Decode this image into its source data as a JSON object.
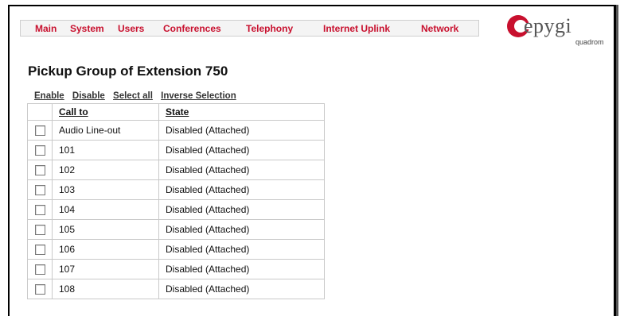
{
  "menu": [
    {
      "label": "Main"
    },
    {
      "label": "System"
    },
    {
      "label": "Users"
    },
    {
      "label": "Conferences"
    },
    {
      "label": "Telephony"
    },
    {
      "label": "Internet Uplink"
    },
    {
      "label": "Network"
    }
  ],
  "brand": {
    "name": "epygi",
    "sub": "quadrom",
    "accent": "#c8102e"
  },
  "page_title": "Pickup Group of Extension 750",
  "actions": {
    "enable": "Enable",
    "disable": "Disable",
    "select_all": "Select all",
    "inverse": "Inverse Selection"
  },
  "table": {
    "headers": {
      "call_to": "Call to",
      "state": "State"
    },
    "rows": [
      {
        "call_to": "Audio Line-out",
        "state": "Disabled (Attached)"
      },
      {
        "call_to": "101",
        "state": "Disabled (Attached)"
      },
      {
        "call_to": "102",
        "state": "Disabled (Attached)"
      },
      {
        "call_to": "103",
        "state": "Disabled (Attached)"
      },
      {
        "call_to": "104",
        "state": "Disabled (Attached)"
      },
      {
        "call_to": "105",
        "state": "Disabled (Attached)"
      },
      {
        "call_to": "106",
        "state": "Disabled (Attached)"
      },
      {
        "call_to": "107",
        "state": "Disabled (Attached)"
      },
      {
        "call_to": "108",
        "state": "Disabled (Attached)"
      }
    ]
  }
}
